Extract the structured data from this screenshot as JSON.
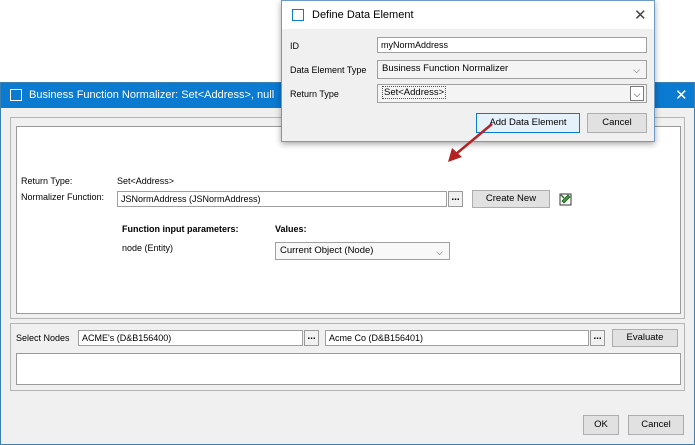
{
  "main_dialog": {
    "title": "Business Function Normalizer: Set<Address>, null",
    "return_type_label": "Return Type:",
    "return_type_value": "Set<Address>",
    "normalizer_label": "Normalizer Function:",
    "normalizer_value": "JSNormAddress (JSNormAddress)",
    "browse_label": "...",
    "create_new_label": "Create New",
    "params_header": "Function input parameters:",
    "values_header": "Values:",
    "param_name": "node (Entity)",
    "param_value": "Current Object (Node)",
    "select_nodes_label": "Select Nodes",
    "node1_value": "ACME's (D&B156400)",
    "node2_value": "Acme Co (D&B156401)",
    "evaluate_label": "Evaluate",
    "ok_label": "OK",
    "cancel_label": "Cancel"
  },
  "popup": {
    "title": "Define Data Element",
    "id_label": "ID",
    "id_value": "myNormAddress",
    "type_label": "Data Element Type",
    "type_value": "Business Function Normalizer",
    "return_label": "Return Type",
    "return_value": "Set<Address>",
    "add_label": "Add Data Element",
    "cancel_label": "Cancel"
  },
  "colors": {
    "title_bar": "#0b7ad1",
    "arrow": "#b22222"
  }
}
